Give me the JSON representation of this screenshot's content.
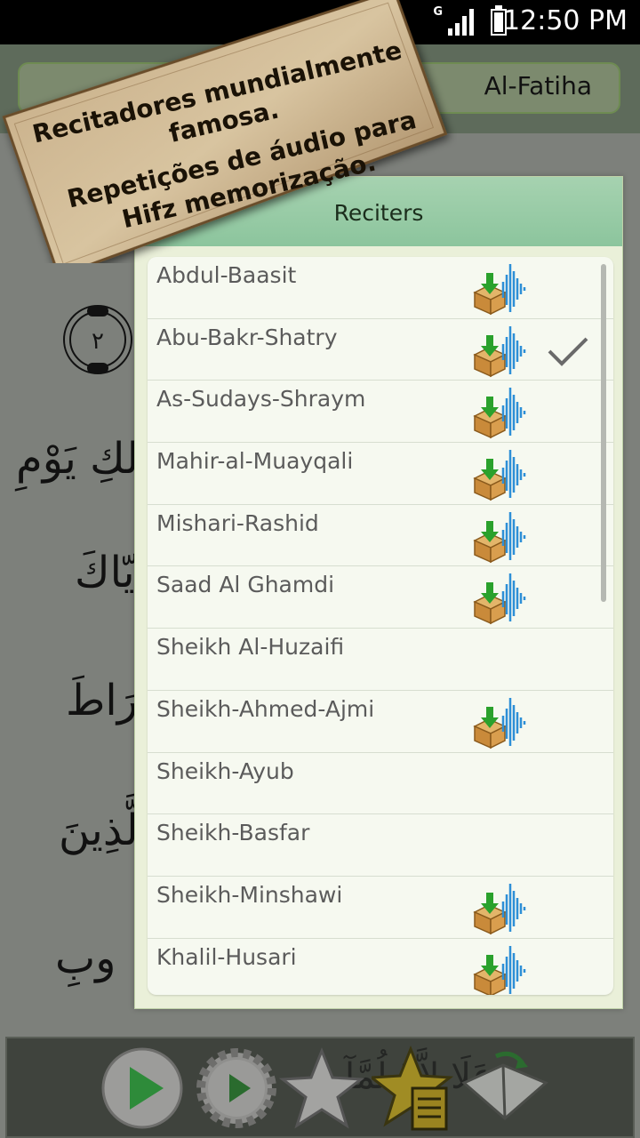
{
  "status_bar": {
    "time": "12:50 PM",
    "network": "G"
  },
  "header": {
    "surah_name": "Al-Fatiha"
  },
  "quran_page": {
    "ayah_number": "٢",
    "lines": [
      "لكِ يَوْمِ",
      "يّاكَ",
      "رَاطَ",
      "لَّذِينَ",
      "وبِ",
      "عَلَا لاَّٱ لُمَّآ"
    ]
  },
  "promo_banner": {
    "lines": [
      "Recitadores mundialmente",
      "famosa.",
      "Repetições de áudio para",
      "Hifz memorização."
    ]
  },
  "dialog": {
    "title": "Reciters",
    "items": [
      {
        "name": "Abdul-Baasit",
        "download_icon": true,
        "selected": false
      },
      {
        "name": "Abu-Bakr-Shatry",
        "download_icon": true,
        "selected": true
      },
      {
        "name": "As-Sudays-Shraym",
        "download_icon": true,
        "selected": false
      },
      {
        "name": "Mahir-al-Muayqali",
        "download_icon": true,
        "selected": false
      },
      {
        "name": "Mishari-Rashid",
        "download_icon": true,
        "selected": false
      },
      {
        "name": "Saad Al Ghamdi",
        "download_icon": true,
        "selected": false
      },
      {
        "name": "Sheikh Al-Huzaifi",
        "download_icon": false,
        "selected": false
      },
      {
        "name": "Sheikh-Ahmed-Ajmi",
        "download_icon": true,
        "selected": false
      },
      {
        "name": "Sheikh-Ayub",
        "download_icon": false,
        "selected": false
      },
      {
        "name": "Sheikh-Basfar",
        "download_icon": false,
        "selected": false
      },
      {
        "name": "Sheikh-Minshawi",
        "download_icon": true,
        "selected": false
      },
      {
        "name": "Khalil-Husari",
        "download_icon": true,
        "selected": false
      }
    ]
  },
  "toolbar": {
    "buttons": [
      "play-icon",
      "play-settings-icon",
      "star-outline-icon",
      "bookmarks-list-icon",
      "open-book-icon"
    ]
  },
  "colors": {
    "title_bar": "#8cc59d",
    "list_bg": "#f6f9f0",
    "play_green": "#2e8b3a"
  }
}
